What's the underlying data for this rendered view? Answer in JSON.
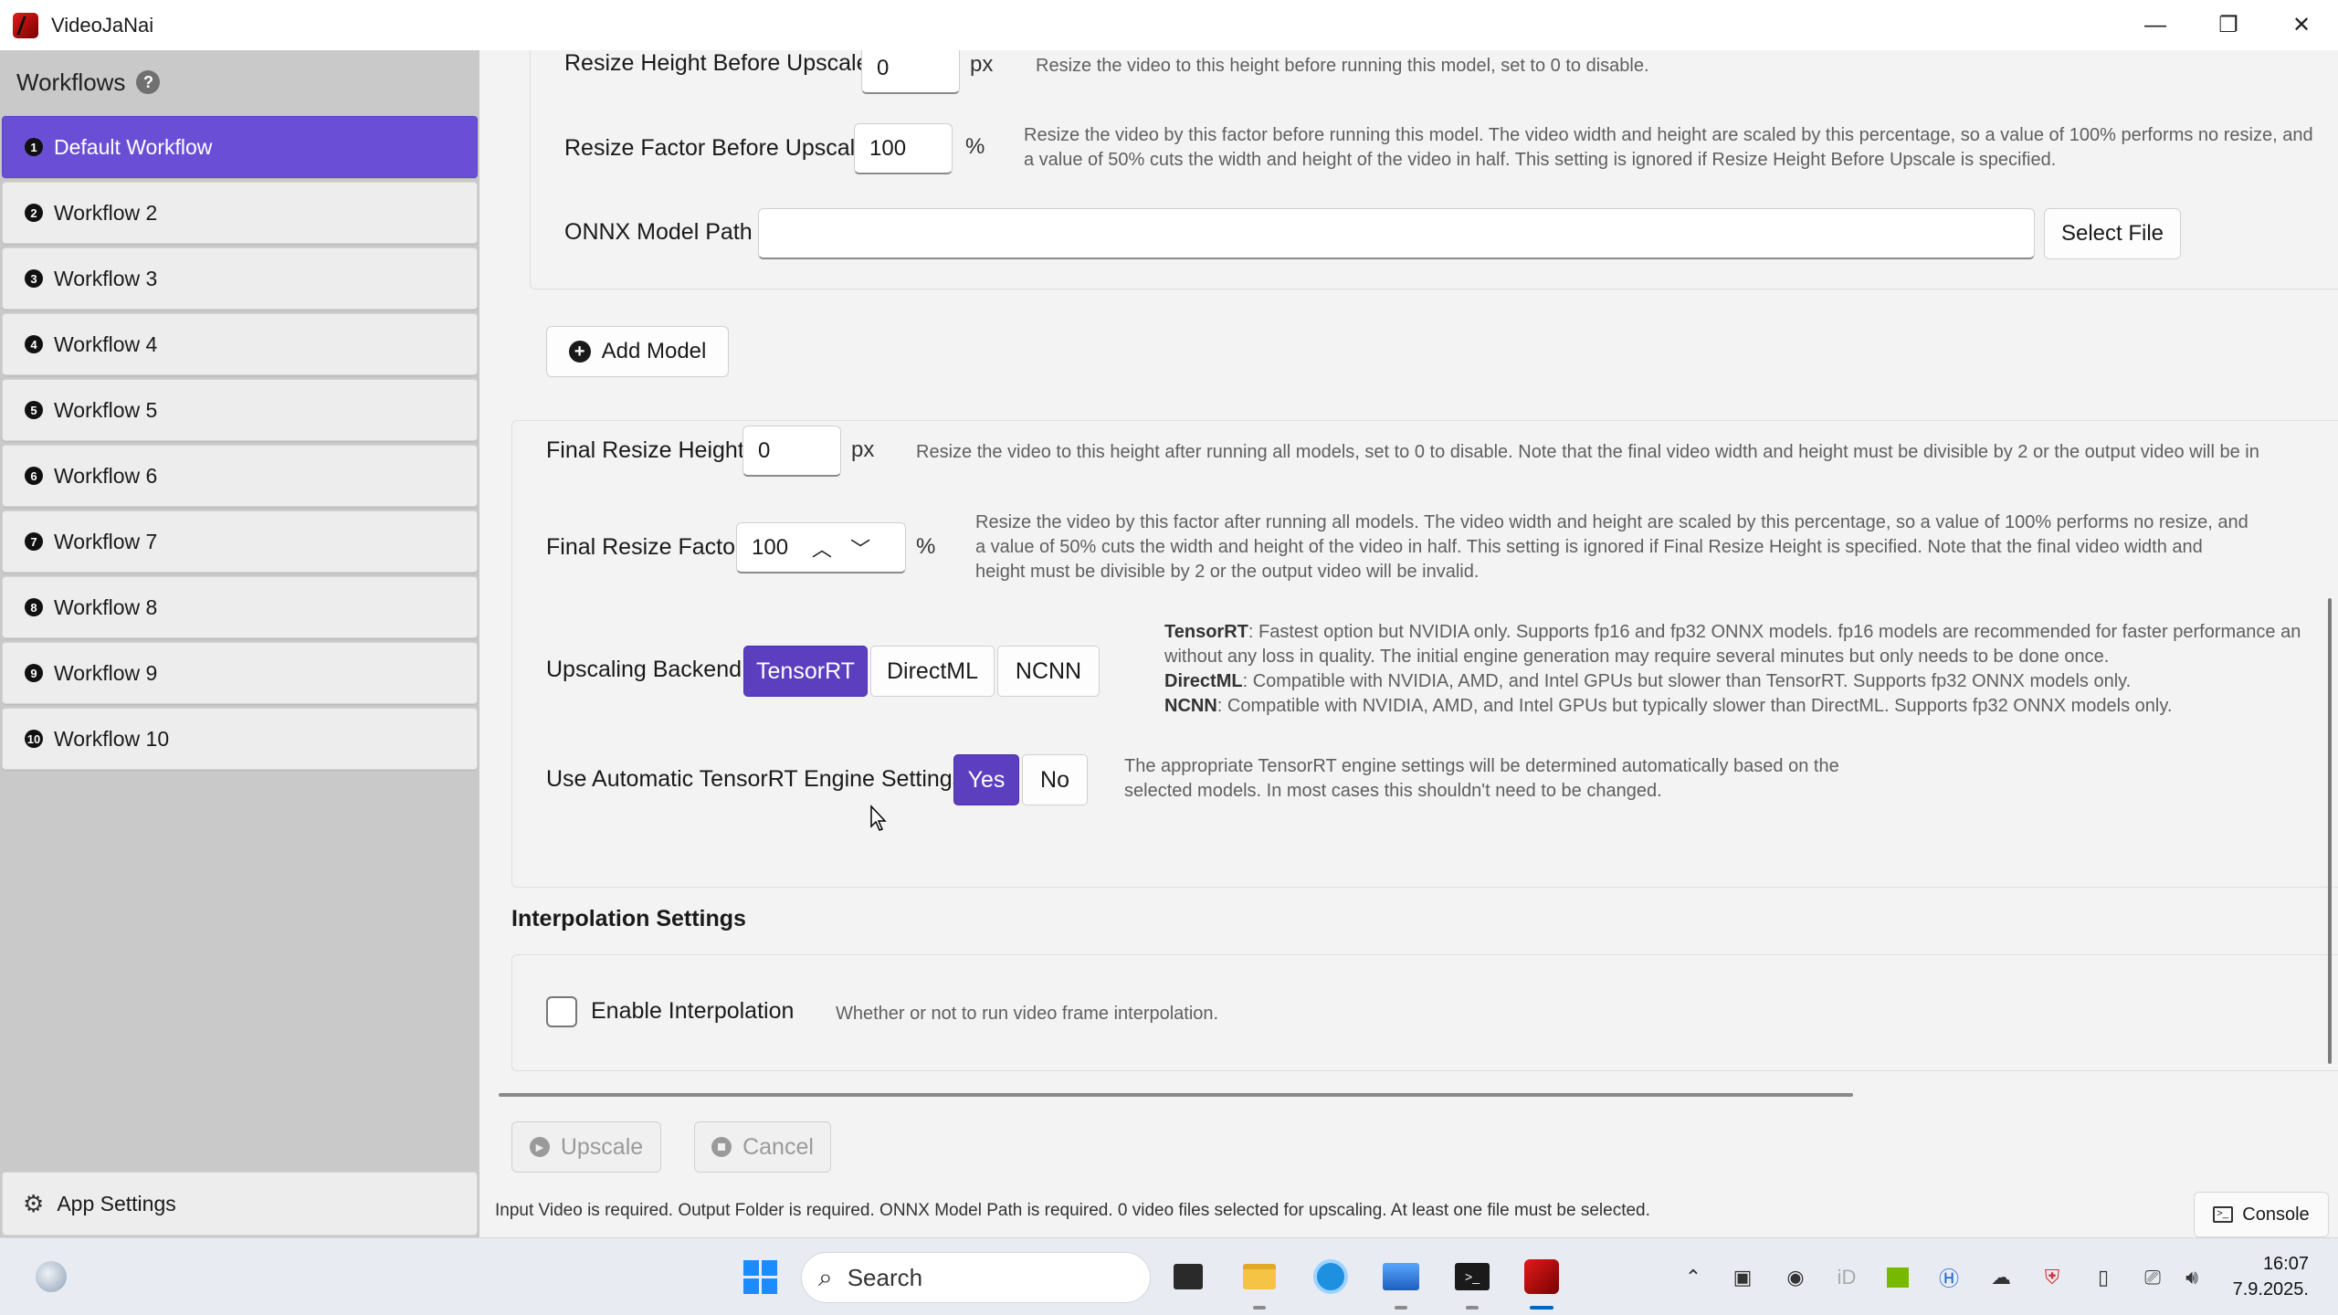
{
  "window": {
    "title": "VideoJaNai",
    "minimize": "—",
    "maximize": "❐",
    "close": "✕"
  },
  "sidebar": {
    "header": "Workflows",
    "help": "?",
    "items": [
      {
        "num": "1",
        "label": "Default Workflow"
      },
      {
        "num": "2",
        "label": "Workflow 2"
      },
      {
        "num": "3",
        "label": "Workflow 3"
      },
      {
        "num": "4",
        "label": "Workflow 4"
      },
      {
        "num": "5",
        "label": "Workflow 5"
      },
      {
        "num": "6",
        "label": "Workflow 6"
      },
      {
        "num": "7",
        "label": "Workflow 7"
      },
      {
        "num": "8",
        "label": "Workflow 8"
      },
      {
        "num": "9",
        "label": "Workflow 9"
      },
      {
        "num": "10",
        "label": "Workflow 10"
      }
    ],
    "app_settings": "App Settings"
  },
  "model": {
    "resize_height_label": "Resize Height Before Upscale",
    "resize_height_value": "0",
    "resize_height_unit": "px",
    "resize_height_desc": "Resize the video to this height before running this model, set to 0 to disable.",
    "resize_factor_label": "Resize Factor Before Upscale",
    "resize_factor_value": "100",
    "resize_factor_unit": "%",
    "resize_factor_desc": "Resize the video by this factor before running this model. The video width and height are scaled by this percentage, so a value of 100% performs no resize, and a value of 50% cuts the width and height of the video in half. This setting is ignored if Resize Height Before Upscale is specified.",
    "onnx_label": "ONNX Model Path",
    "onnx_value": "",
    "select_file": "Select File"
  },
  "add_model": "Add Model",
  "final": {
    "height_label": "Final Resize Height",
    "height_value": "0",
    "height_unit": "px",
    "height_desc": "Resize the video to this height after running all models, set to 0 to disable. Note that the final video width and height must be divisible by 2 or the output video will be in",
    "factor_label": "Final Resize Factor",
    "factor_value": "100",
    "factor_unit": "%",
    "factor_desc": "Resize the video by this factor after running all models. The video width and height are scaled by this percentage, so a value of 100% performs no resize, and a value of 50% cuts the width and height of the video in half. This setting is ignored if Final Resize Height is specified. Note that the final video width and height must be divisible by 2 or the output video will be invalid."
  },
  "backend": {
    "label": "Upscaling Backend",
    "options": [
      "TensorRT",
      "DirectML",
      "NCNN"
    ],
    "selected": "TensorRT",
    "desc_tensorrt_name": "TensorRT",
    "desc_tensorrt": ": Fastest option but NVIDIA only. Supports fp16 and fp32 ONNX models. fp16 models are recommended for faster performance an without any loss in quality. The initial engine generation may require several minutes but only needs to be done once.",
    "desc_directml_name": "DirectML",
    "desc_directml": ": Compatible with NVIDIA, AMD, and Intel GPUs but slower than TensorRT. Supports fp32 ONNX models only.",
    "desc_ncnn_name": "NCNN",
    "desc_ncnn": ": Compatible with NVIDIA, AMD, and Intel GPUs but typically slower than DirectML. Supports fp32 ONNX models only."
  },
  "auto_trt": {
    "label": "Use Automatic TensorRT Engine Settings",
    "yes": "Yes",
    "no": "No",
    "selected": "Yes",
    "desc": "The appropriate TensorRT engine settings will be determined automatically based on the selected models. In most cases this shouldn't need to be changed."
  },
  "interpolation": {
    "section_title": "Interpolation Settings",
    "enable_label": "Enable Interpolation",
    "enabled": false,
    "desc": "Whether or not to run video frame interpolation."
  },
  "actions": {
    "upscale": "Upscale",
    "cancel": "Cancel"
  },
  "status": "Input Video is required. Output Folder is required. ONNX Model Path is required. 0 video files selected for upscaling. At least one file must be selected.",
  "console": "Console",
  "taskbar": {
    "search_placeholder": "Search",
    "time": "16:07",
    "date": "7.9.2025."
  },
  "colors": {
    "accent": "#6a4fd6",
    "selected_segment": "#5b3fbf",
    "sidebar_bg": "#c9c9c9"
  }
}
